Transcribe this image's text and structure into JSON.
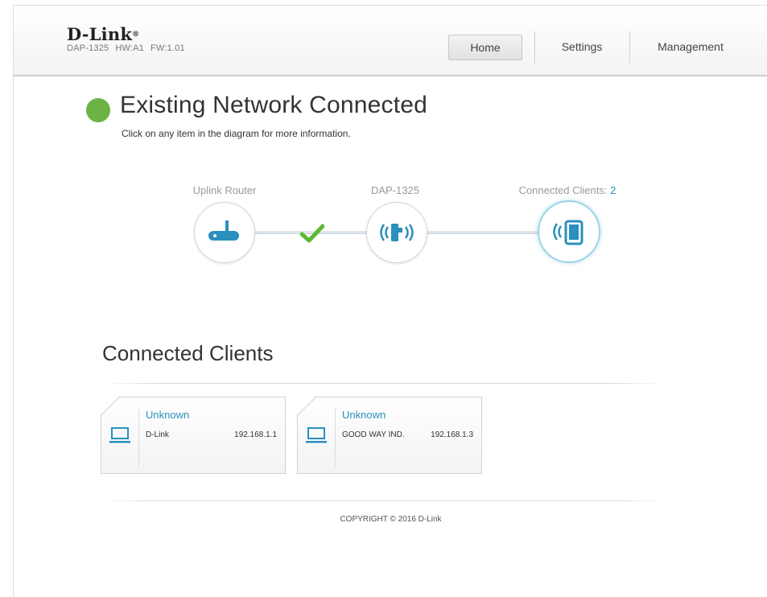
{
  "header": {
    "logo": "D-Link",
    "logo_mark": "®",
    "model": "DAP-1325",
    "hw": "HW:A1",
    "fw": "FW:1.01"
  },
  "nav": {
    "home": "Home",
    "settings": "Settings",
    "management": "Management"
  },
  "status": {
    "title": "Existing Network Connected",
    "subtitle": "Click on any item in the diagram for more information.",
    "color": "#6ab344"
  },
  "diagram": {
    "uplink_label": "Uplink Router",
    "device_label": "DAP-1325",
    "clients_label": "Connected Clients:",
    "clients_count": "2",
    "accent": "#2a8fbd",
    "check_color": "#5cb836"
  },
  "clients": {
    "title": "Connected Clients",
    "items": [
      {
        "name": "Unknown",
        "vendor": "D-Link",
        "ip": "192.168.1.1",
        "icon": "laptop-icon"
      },
      {
        "name": "Unknown",
        "vendor": "GOOD WAY IND.",
        "ip": "192.168.1.3",
        "icon": "laptop-icon"
      }
    ]
  },
  "footer": {
    "copyright": "COPYRIGHT © 2016 D-Link"
  }
}
